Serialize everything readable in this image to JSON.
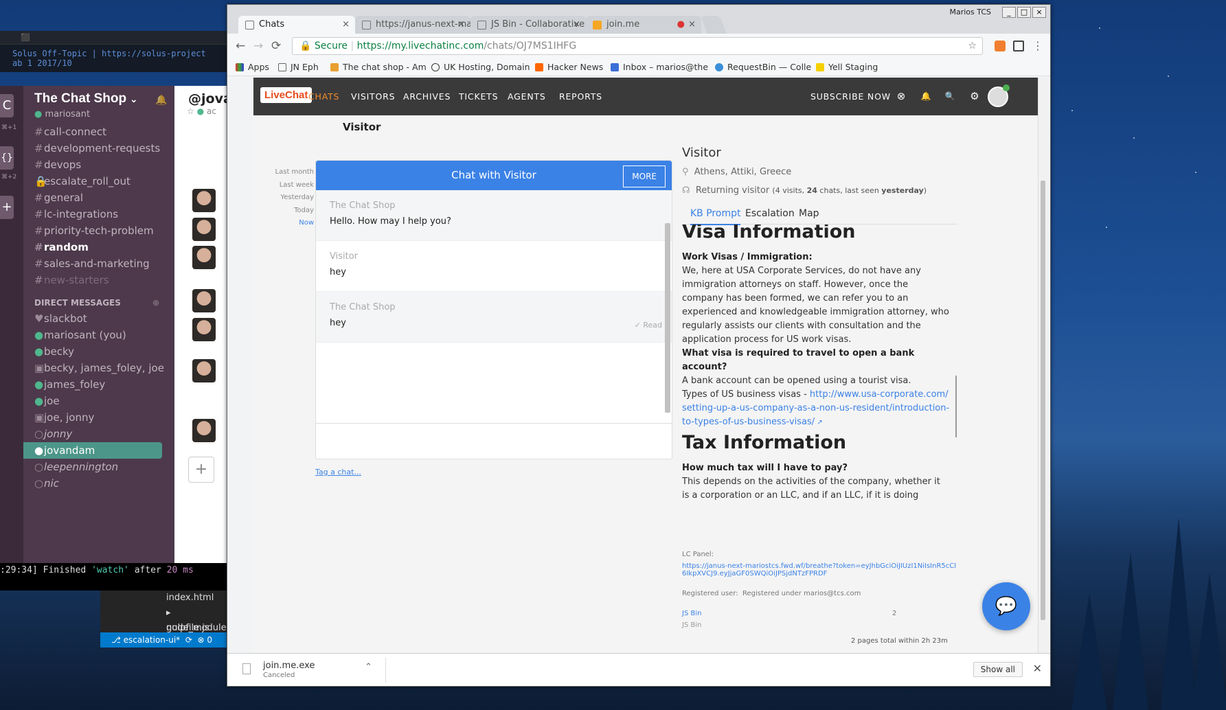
{
  "terminal": {
    "header": "⬛",
    "line1": "Solus Off-Topic | https://solus-project",
    "line2": "ab     1 2017/10"
  },
  "slack": {
    "rail": {
      "workspace1": "C",
      "shortcut1": "⌘+1",
      "workspace2": "{}",
      "shortcut2": "⌘+2",
      "add": "+"
    },
    "team_name": "The Chat Shop",
    "team_caret": "⌄",
    "username": "mariosant",
    "bell": "🔔",
    "channels": [
      {
        "prefix": "#",
        "name": "call-connect",
        "style": ""
      },
      {
        "prefix": "#",
        "name": "development-requests",
        "style": ""
      },
      {
        "prefix": "#",
        "name": "devops",
        "style": ""
      },
      {
        "prefix": "🔒",
        "name": "escalate_roll_out",
        "style": ""
      },
      {
        "prefix": "#",
        "name": "general",
        "style": ""
      },
      {
        "prefix": "#",
        "name": "lc-integrations",
        "style": ""
      },
      {
        "prefix": "#",
        "name": "priority-tech-problem",
        "style": ""
      },
      {
        "prefix": "#",
        "name": "random",
        "style": "b"
      },
      {
        "prefix": "#",
        "name": "sales-and-marketing",
        "style": ""
      },
      {
        "prefix": "#",
        "name": "new-starters",
        "style": "dim"
      }
    ],
    "dm_header": "DIRECT MESSAGES",
    "dm_add": "⊕",
    "dms": [
      {
        "prefix": "♥",
        "name": "slackbot",
        "style": ""
      },
      {
        "prefix": "●",
        "name": "mariosant (you)",
        "style": ""
      },
      {
        "prefix": "●",
        "name": "becky",
        "style": ""
      },
      {
        "prefix": "▣",
        "name": "becky, james_foley, joe",
        "style": ""
      },
      {
        "prefix": "●",
        "name": "james_foley",
        "style": ""
      },
      {
        "prefix": "●",
        "name": "joe",
        "style": ""
      },
      {
        "prefix": "▣",
        "name": "joe, jonny",
        "style": ""
      },
      {
        "prefix": "○",
        "name": "jonny",
        "style": "it"
      },
      {
        "prefix": "●",
        "name": "jovandam",
        "style": "act"
      },
      {
        "prefix": "○",
        "name": "leepennington",
        "style": "it"
      },
      {
        "prefix": "○",
        "name": "nic",
        "style": "it"
      }
    ],
    "main_title": "@jovan",
    "star": "☆",
    "status": "ac",
    "compose_plus": "+"
  },
  "bottom_terminal": {
    "time": ":29:34]",
    "t1": " Finished ",
    "watch": "'watch'",
    "t2": " after ",
    "ms": "20 ms"
  },
  "vscode": {
    "files": [
      "index.html",
      "node_modules",
      "gulpfile.js"
    ],
    "branch": "⎇ escalation-ui*",
    "sync": "⟳",
    "errors": "⊗ 0"
  },
  "chrome": {
    "tabs": [
      {
        "title": "Chats",
        "active": true
      },
      {
        "title": "https://janus-next-ma",
        "active": false
      },
      {
        "title": "JS Bin - Collaborative",
        "active": false
      },
      {
        "title": "join.me",
        "active": false
      }
    ],
    "tab_close": "×",
    "recording": "●",
    "window_title": "Marios TCS",
    "min": "_",
    "max": "□",
    "close": "×",
    "back": "←",
    "forward": "→",
    "reload": "⟳",
    "secure": "🔒 Secure",
    "url_sep": " | ",
    "url_domain": "https://my.livechatinc.com",
    "url_path": "/chats/OJ7MS1IHFG",
    "star": "☆",
    "menu": "⋮",
    "bookmarks": [
      "Apps",
      "JN Eph",
      "The chat shop - Am",
      "UK Hosting, Domain",
      "Hacker News",
      "Inbox – marios@the",
      "RequestBin — Colle",
      "Yell Staging"
    ]
  },
  "livechat": {
    "logo": "LiveChat",
    "nav": [
      "CHATS",
      "VISITORS",
      "ARCHIVES",
      "TICKETS",
      "AGENTS",
      "REPORTS"
    ],
    "subscribe": "SUBSCRIBE NOW",
    "icons": [
      "⊗",
      "🔔",
      "🔍",
      "⚙"
    ],
    "page_title": "Visitor",
    "timeline": [
      "Last month",
      "Last week",
      "Yesterday",
      "Today",
      "Now"
    ],
    "chat_header": "Chat with Visitor",
    "more": "MORE",
    "messages": [
      {
        "who": "The Chat Shop",
        "text": "Hello. How may I help you?",
        "status": ""
      },
      {
        "who": "Visitor",
        "text": "hey",
        "status": ""
      },
      {
        "who": "The Chat Shop",
        "text": "hey",
        "status": "✓ Read"
      }
    ],
    "tag_link": "Tag a chat...",
    "visitor": {
      "name": "Visitor",
      "location": "Athens, Attiki, Greece",
      "returning": "Returning visitor",
      "visits_pre": "(",
      "visits_n": "4 visits, ",
      "chats_n": "24",
      "chats_mid": " chats, last seen ",
      "last": "yesterday",
      "visits_post": ")"
    },
    "tabs": [
      "KB Prompt",
      "Escalation",
      "Map"
    ],
    "kb": {
      "h1": "Visa Information",
      "q1": "Work Visas / Immigration:",
      "a1": "We, here at USA Corporate Services, do not have any immigration attorneys on staff. However, once the company has been formed, we can refer you to an experienced and knowledgeable immigration attorney, who regularly assists our clients with consultation and the application process for US work visas.",
      "q2": "What visa is required to travel to open a bank account?",
      "a2": "A bank account can be opened using a tourist visa.",
      "a3_pre": "Types of US business visas - ",
      "a3_link": "http://www.usa-corporate.com/setting-up-a-us-company-as-a-non-us-resident/introduction-to-types-of-us-business-visas/",
      "h2": "Tax Information",
      "q3": "How much tax will I have to pay?",
      "a4": "This depends on the activities of the company, whether it is a corporation or an LLC, and if an LLC, if it is doing business in the United States. Some of the types of the company the"
    },
    "meta": {
      "panel_label": "LC Panel:",
      "panel_link": "https://janus-next-mariostcs.fwd.wf/breathe?token=eyJhbGciOiJIUzI1NiIsInR5cCI6IkpXVCJ9.eyJjaGF0SWQiOiJPSjdNTzFPRDF",
      "reg_label": "Registered user:",
      "reg_value": "Registered under marios@tcs.com",
      "jsbin_link": "JS Bin",
      "jsbin_text": "JS Bin",
      "page_count": "2"
    },
    "fab": "💬",
    "pages_summary": "2 pages total within 2h 23m"
  },
  "download": {
    "filename": "join.me.exe",
    "status": "Canceled",
    "chevron": "⌃",
    "show_all": "Show all",
    "close": "✕"
  }
}
